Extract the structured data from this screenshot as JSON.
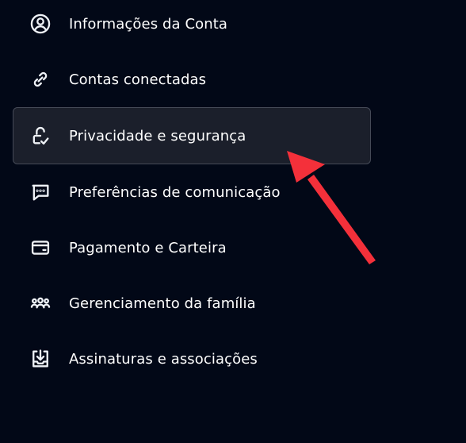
{
  "menu": {
    "items": [
      {
        "label": "Informações da Conta",
        "icon": "user-circle-icon"
      },
      {
        "label": "Contas conectadas",
        "icon": "link-icon"
      },
      {
        "label": "Privacidade e segurança",
        "icon": "privacy-lock-icon",
        "active": true
      },
      {
        "label": "Preferências de comunicação",
        "icon": "message-icon"
      },
      {
        "label": "Pagamento e Carteira",
        "icon": "wallet-icon"
      },
      {
        "label": "Gerenciamento da família",
        "icon": "family-icon"
      },
      {
        "label": "Assinaturas e associações",
        "icon": "subscriptions-icon"
      }
    ]
  },
  "colors": {
    "background": "#020817",
    "active_background": "#1b1f2b",
    "active_border": "#454a57",
    "text": "#ffffff",
    "arrow": "#f4303a"
  }
}
